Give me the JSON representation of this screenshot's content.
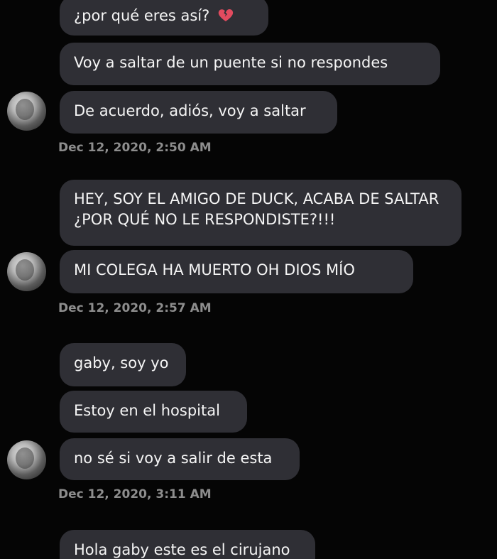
{
  "messages": [
    {
      "text": "¿por qué eres así?",
      "emoji": "broken-heart-icon"
    },
    {
      "text": "Voy a saltar de un puente si no respondes"
    },
    {
      "text": "De acuerdo, adiós, voy a saltar"
    },
    {
      "text": "HEY, SOY EL AMIGO DE DUCK,  ACABA DE SALTAR ¿POR QUÉ NO LE RESPONDISTE?!!!"
    },
    {
      "text": "MI COLEGA HA MUERTO OH DIOS MÍO"
    },
    {
      "text": "gaby, soy yo"
    },
    {
      "text": "Estoy en el hospital"
    },
    {
      "text": "no sé si voy a salir de esta"
    },
    {
      "text": "Hola gaby este es el cirujano"
    }
  ],
  "timestamps": [
    "Dec 12, 2020, 2:50 AM",
    "Dec 12, 2020, 2:57 AM",
    "Dec 12, 2020, 3:11 AM"
  ],
  "colors": {
    "background": "#050505",
    "bubble": "#2f2f35",
    "timestamp": "#8d8d8d",
    "heart": "#e24b5f"
  }
}
